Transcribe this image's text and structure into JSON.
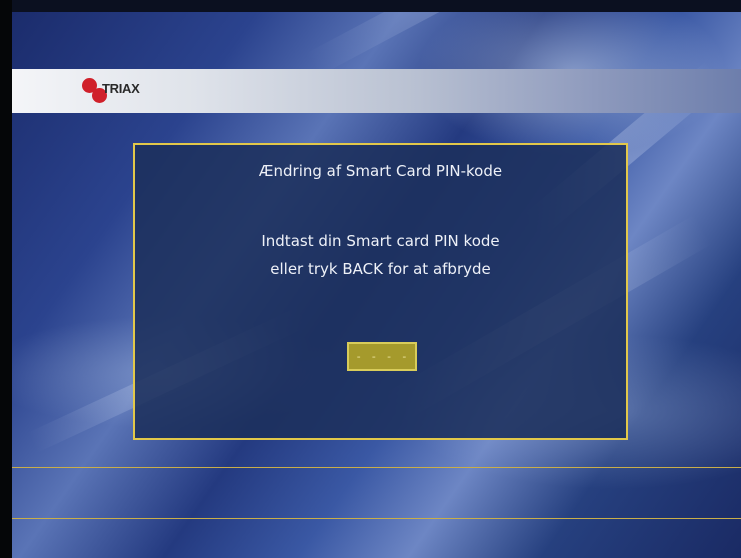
{
  "brand": {
    "logo_text": "TRIAX",
    "colors": {
      "logo_red": "#d0202a",
      "dialog_border": "#e2c84a",
      "pin_field": "#a59a2c"
    }
  },
  "dialog": {
    "title": "Ændring af Smart Card  PIN-kode",
    "message_line1": "Indtast din Smart card PIN kode",
    "message_line2": "eller tryk BACK for at afbryde",
    "pin_placeholder": "- - - -"
  }
}
